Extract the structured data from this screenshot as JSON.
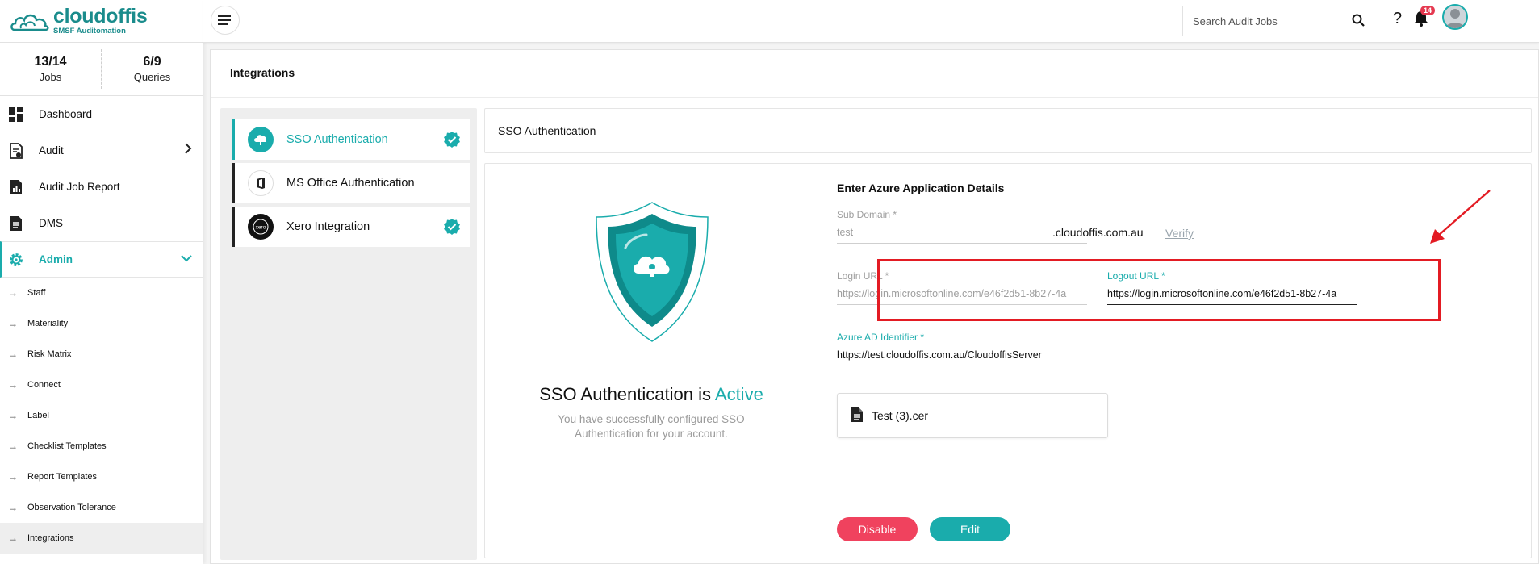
{
  "brand": {
    "name": "cloudoffis",
    "tagline": "SMSF Auditomation"
  },
  "stats": [
    {
      "value": "13/14",
      "label": "Jobs"
    },
    {
      "value": "6/9",
      "label": "Queries"
    }
  ],
  "nav": {
    "dashboard": "Dashboard",
    "audit": "Audit",
    "audit_job_report": "Audit Job Report",
    "dms": "DMS",
    "admin": "Admin"
  },
  "admin_items": [
    "Staff",
    "Materiality",
    "Risk Matrix",
    "Connect",
    "Label",
    "Checklist Templates",
    "Report Templates",
    "Observation Tolerance",
    "Integrations"
  ],
  "topbar": {
    "search_placeholder": "Search Audit Jobs",
    "notifications": "14",
    "help": "?"
  },
  "page": {
    "title": "Integrations"
  },
  "integrations": [
    {
      "label": "SSO Authentication",
      "verified": true
    },
    {
      "label": "MS Office Authentication",
      "verified": false
    },
    {
      "label": "Xero Integration",
      "verified": true
    }
  ],
  "sso": {
    "header": "SSO Authentication",
    "status_prefix": "SSO Authentication is ",
    "status_word": "Active",
    "status_desc": "You have successfully configured SSO Authentication for your account.",
    "form_title": "Enter Azure Application Details",
    "sub_domain_label": "Sub Domain",
    "sub_domain_value": "test",
    "domain_suffix": ".cloudoffis.com.au",
    "verify": "Verify",
    "login_url_label": "Login URL",
    "login_url_value": "https://login.microsoftonline.com/e46f2d51-8b27-4a",
    "logout_url_label": "Logout URL",
    "logout_url_value": "https://login.microsoftonline.com/e46f2d51-8b27-4a",
    "azure_ad_label": "Azure AD Identifier",
    "azure_ad_value": "https://test.cloudoffis.com.au/CloudoffisServer",
    "required_mark": "*",
    "file_name": "Test (3).cer",
    "disable": "Disable",
    "edit": "Edit"
  },
  "colors": {
    "accent": "#1aacac",
    "danger": "#f0425e",
    "annotation": "#e31b23"
  }
}
